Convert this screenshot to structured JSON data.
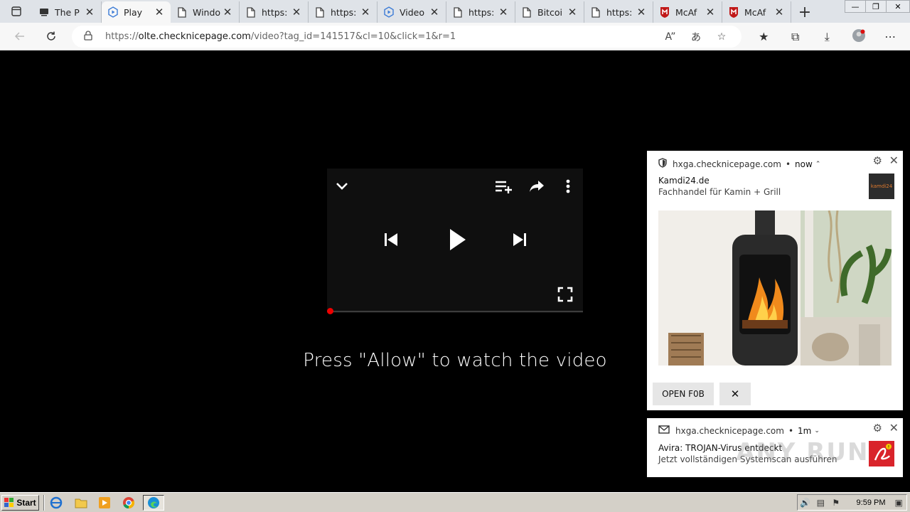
{
  "browser": {
    "tabs": [
      {
        "label": "The P",
        "icon": "window-icon",
        "active": false
      },
      {
        "label": "Play",
        "icon": "play-icon",
        "active": true
      },
      {
        "label": "Windo",
        "icon": "page-icon",
        "active": false
      },
      {
        "label": "https:",
        "icon": "page-icon",
        "active": false
      },
      {
        "label": "https:",
        "icon": "page-icon",
        "active": false
      },
      {
        "label": "Video",
        "icon": "play-icon",
        "active": false
      },
      {
        "label": "https:",
        "icon": "page-icon",
        "active": false
      },
      {
        "label": "Bitcoi",
        "icon": "page-icon",
        "active": false
      },
      {
        "label": "https:",
        "icon": "page-icon",
        "active": false
      },
      {
        "label": "McAf",
        "icon": "mcafee-icon",
        "active": false
      },
      {
        "label": "McAf",
        "icon": "mcafee-icon",
        "active": false
      }
    ],
    "address": {
      "scheme": "https://",
      "host": "olte.checknicepage.com",
      "path": "/video?tag_id=141517&cl=10&click=1&r=1"
    }
  },
  "page": {
    "prompt": "Press \"Allow\" to watch the video",
    "progress_fraction": 0.0
  },
  "notifications": [
    {
      "site": "hxga.checknicepage.com",
      "time": "now",
      "title": "Kamdi24.de",
      "body": "Fachhandel für Kamin + Grill",
      "badge": "kamdi24",
      "action_label": "OPEN F0B"
    },
    {
      "site": "hxga.checknicepage.com",
      "time": "1m",
      "title": "Avira: TROJAN-Virus entdeckt",
      "body": "Jetzt vollständigen Systemscan ausführen"
    }
  ],
  "taskbar": {
    "start_label": "Start",
    "clock": "9:59 PM"
  },
  "watermark": "ANY RUN",
  "colors": {
    "progress_dot": "#ee0000",
    "mcafee": "#c01818",
    "avira": "#d9242b"
  }
}
